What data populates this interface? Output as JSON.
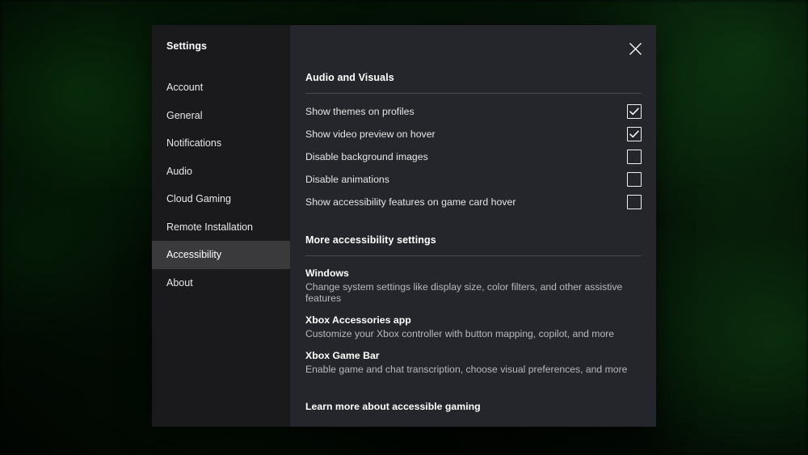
{
  "sidebar": {
    "title": "Settings",
    "items": [
      {
        "label": "Account",
        "selected": false
      },
      {
        "label": "General",
        "selected": false
      },
      {
        "label": "Notifications",
        "selected": false
      },
      {
        "label": "Audio",
        "selected": false
      },
      {
        "label": "Cloud Gaming",
        "selected": false
      },
      {
        "label": "Remote Installation",
        "selected": false
      },
      {
        "label": "Accessibility",
        "selected": true
      },
      {
        "label": "About",
        "selected": false
      }
    ]
  },
  "close_button": {
    "icon": "close-icon"
  },
  "audio_visuals": {
    "heading": "Audio and Visuals",
    "toggles": [
      {
        "label": "Show themes on profiles",
        "checked": true
      },
      {
        "label": "Show video preview on hover",
        "checked": true
      },
      {
        "label": "Disable background images",
        "checked": false
      },
      {
        "label": "Disable animations",
        "checked": false
      },
      {
        "label": "Show accessibility features on game card hover",
        "checked": false
      }
    ]
  },
  "more_accessibility": {
    "heading": "More accessibility settings",
    "links": [
      {
        "title": "Windows",
        "description": "Change system settings like display size, color filters, and other assistive features"
      },
      {
        "title": "Xbox Accessories app",
        "description": "Customize your Xbox controller with button mapping, copilot, and more"
      },
      {
        "title": "Xbox Game Bar",
        "description": "Enable game and chat transcription, choose visual preferences, and more"
      }
    ],
    "learn_more": "Learn more about accessible gaming"
  },
  "colors": {
    "dialog_background": "#25262b",
    "sidebar_background": "#1a1a1d",
    "selected_item_background": "#3a3a3d",
    "divider": "#4a4b50",
    "primary_text": "#ffffff",
    "secondary_text": "#b8b9bd",
    "accent_green": "#107c10"
  }
}
